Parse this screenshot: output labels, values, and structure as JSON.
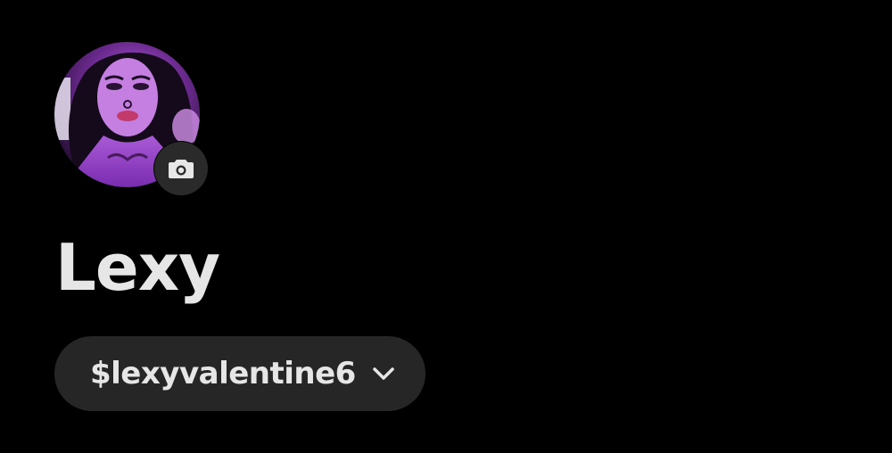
{
  "profile": {
    "display_name": "Lexy",
    "cashtag": "$lexyvalentine6",
    "avatar_icon": "profile-photo",
    "camera_icon": "camera-icon",
    "cashtag_menu_icon": "chevron-down-icon"
  },
  "colors": {
    "background": "#000000",
    "text": "#e6e6e6",
    "pill": "#262626",
    "badge": "#2a2a2a",
    "avatar_tint": "#9b3fd0"
  }
}
